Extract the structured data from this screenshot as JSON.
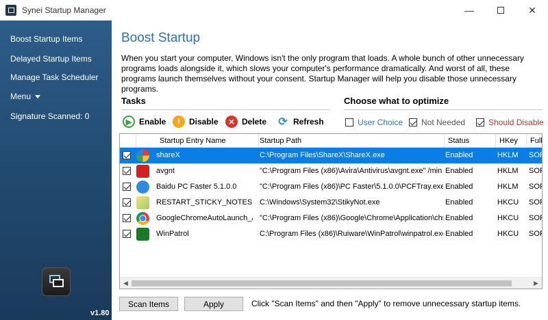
{
  "window": {
    "title": "Synei Startup Manager",
    "minimize_glyph": "—",
    "close_glyph": "✕"
  },
  "sidebar": {
    "items": [
      {
        "label": "Boost Startup Items"
      },
      {
        "label": "Delayed Startup Items"
      },
      {
        "label": "Manage Task Scheduler"
      },
      {
        "label": "Menu"
      },
      {
        "label": "Signature Scanned: 0"
      }
    ],
    "version": "v1.80"
  },
  "main": {
    "title": "Boost Startup",
    "description": "When you start your computer, Windows isn't the only program that loads. A whole bunch of other unnecessary programs loads alongside it, which slows your computer's performance dramatically. And worst of all, these programs launch themselves without your consent. Startup Manager will help you disable those unnecessary programs.",
    "tasks_label": "Tasks",
    "choose_label": "Choose what to optimize"
  },
  "toolbar": {
    "enable": "Enable",
    "disable": "Disable",
    "delete": "Delete",
    "refresh": "Refresh"
  },
  "optimize": {
    "user_choice": {
      "label": "User Choice",
      "checked": false,
      "color": "#2b70b5"
    },
    "not_needed": {
      "label": "Not Needed",
      "checked": true,
      "color": "#555555"
    },
    "should_disable": {
      "label": "Should Disable",
      "checked": true,
      "color": "#b03a2e"
    }
  },
  "table": {
    "columns": [
      "Startup Entry Name",
      "Startup Path",
      "Status",
      "HKey",
      "Full"
    ],
    "rows": [
      {
        "name": "shareX",
        "path": "C:\\Program Files\\ShareX\\ShareX.exe",
        "status": "Enabled",
        "hkey": "HKLM",
        "full": "SOF",
        "icon": "sharex-icon",
        "selected": true
      },
      {
        "name": "avgnt",
        "path": "\"C:\\Program Files (x86)\\Avira\\Antivirus\\avgnt.exe\" /min",
        "status": "Enabled",
        "hkey": "HKLM",
        "full": "SOF",
        "icon": "avira-icon",
        "selected": false
      },
      {
        "name": "Baidu PC Faster 5.1.0.0",
        "path": "\"C:\\Program Files (x86)\\PC Faster\\5.1.0.0\\PCFTray.exe\" ...",
        "status": "Enabled",
        "hkey": "HKLM",
        "full": "SOF",
        "icon": "baidu-pc-faster-icon",
        "selected": false
      },
      {
        "name": "RESTART_STICKY_NOTES",
        "path": "C:\\Windows\\System32\\StikyNot.exe",
        "status": "Enabled",
        "hkey": "HKCU",
        "full": "SOF",
        "icon": "sticky-notes-icon",
        "selected": false
      },
      {
        "name": "GoogleChromeAutoLaunch_A...",
        "path": "\"C:\\Program Files (x86)\\Google\\Chrome\\Application\\chro...",
        "status": "Enabled",
        "hkey": "HKCU",
        "full": "SOF",
        "icon": "chrome-icon",
        "selected": false
      },
      {
        "name": "WinPatrol",
        "path": "C:\\Program Files (x86)\\Ruiware\\WinPatrol\\winpatrol.exe",
        "status": "Enabled",
        "hkey": "HKCU",
        "full": "SOF",
        "icon": "winpatrol-icon",
        "selected": false
      }
    ]
  },
  "footer": {
    "scan_label": "Scan Items",
    "apply_label": "Apply",
    "hint": "Click \"Scan Items\" and then \"Apply\" to remove unnecessary startup items."
  }
}
